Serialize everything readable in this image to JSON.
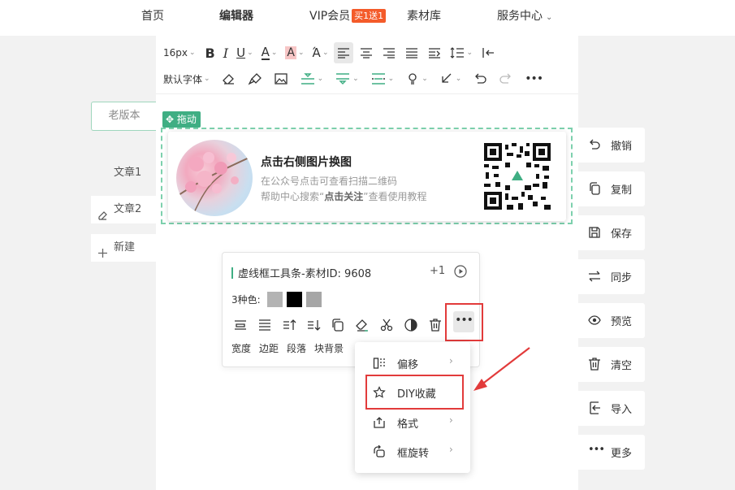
{
  "nav": {
    "home": "首页",
    "editor": "编辑器",
    "vip": "VIP会员",
    "vip_badge": "买1送1",
    "materials": "素材库",
    "service": "服务中心"
  },
  "toolbar": {
    "font_size": "16px",
    "default_font": "默认字体"
  },
  "left": {
    "old_version": "老版本",
    "article1": "文章1",
    "article2": "文章2",
    "new": "新建"
  },
  "block": {
    "drag_label": "拖动",
    "title": "点击右侧图片换图",
    "line1": "在公众号点击可查看扫描二维码",
    "line2_pre": "帮助中心搜索“",
    "line2_bold": "点击关注",
    "line2_post": "”查看使用教程"
  },
  "tool": {
    "title": "虚线框工具条-素材ID: 9608",
    "plus": "+1",
    "colors_label": "3种色:",
    "colors": [
      "#b3b3b3",
      "#000000",
      "#a6a6a6"
    ],
    "labels": [
      "宽度",
      "边距",
      "段落",
      "块背景"
    ]
  },
  "menu": {
    "items": [
      {
        "label": "偏移",
        "icon": "offset-icon",
        "arrow": "›"
      },
      {
        "label": "DIY收藏",
        "icon": "star-icon",
        "arrow": ""
      },
      {
        "label": "格式",
        "icon": "format-icon",
        "arrow": "›"
      },
      {
        "label": "框旋转",
        "icon": "rotate-icon",
        "arrow": "›"
      }
    ]
  },
  "right": {
    "undo": "撤销",
    "copy": "复制",
    "save": "保存",
    "sync": "同步",
    "preview": "预览",
    "clear": "清空",
    "import": "导入",
    "more": "更多"
  },
  "colors": {
    "accent": "#3fae83",
    "highlight": "#e23b3b",
    "vip": "#f45b2a"
  }
}
